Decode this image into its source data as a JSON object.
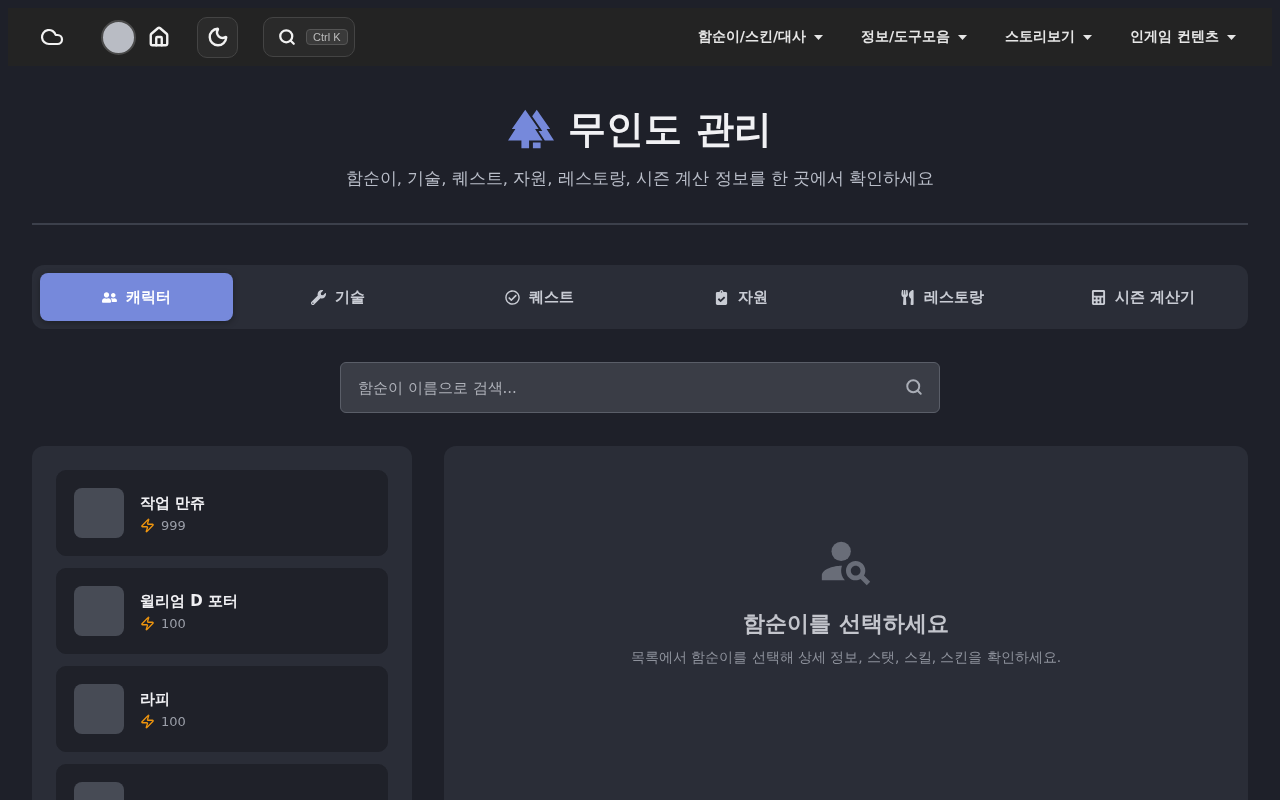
{
  "navbar": {
    "search_shortcut": "Ctrl K",
    "menus": [
      {
        "label": "함순이/스킨/대사"
      },
      {
        "label": "정보/도구모음"
      },
      {
        "label": "스토리보기"
      },
      {
        "label": "인게임 컨텐츠"
      }
    ]
  },
  "header": {
    "title": "무인도 관리",
    "subtitle": "함순이, 기술, 퀘스트, 자원, 레스토랑, 시즌 계산 정보를 한 곳에서 확인하세요"
  },
  "tabs": [
    {
      "label": "캐릭터",
      "selected": true
    },
    {
      "label": "기술",
      "selected": false
    },
    {
      "label": "퀘스트",
      "selected": false
    },
    {
      "label": "자원",
      "selected": false
    },
    {
      "label": "레스토랑",
      "selected": false
    },
    {
      "label": "시즌 계산기",
      "selected": false
    }
  ],
  "search": {
    "placeholder": "함순이 이름으로 검색..."
  },
  "characters": [
    {
      "name": "작업 만쥬",
      "energy": "999",
      "selected": false
    },
    {
      "name": "윌리엄 D 포터",
      "energy": "100",
      "selected": false
    },
    {
      "name": "라피",
      "energy": "100",
      "selected": false
    },
    {
      "selected": false
    }
  ],
  "detail": {
    "title": "함순이를 선택하세요",
    "description": "목록에서 함순이를 선택해 상세 정보, 스탯, 스킬, 스킨을 확인하세요."
  }
}
